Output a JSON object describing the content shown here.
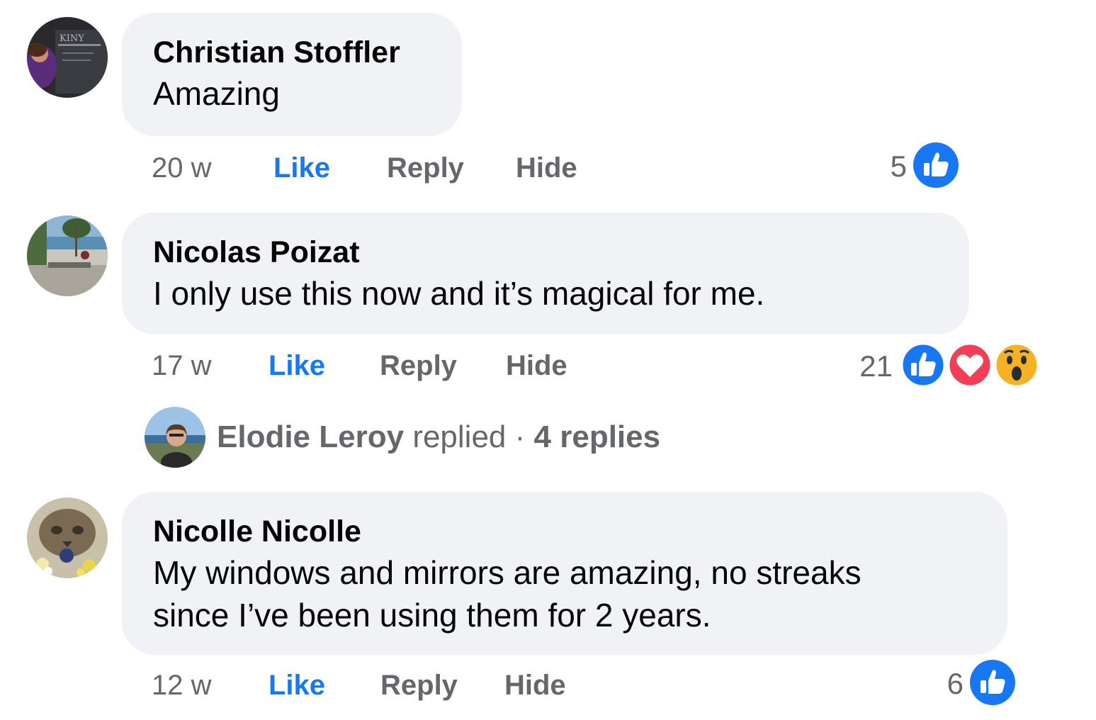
{
  "comments": [
    {
      "author": "Christian Stoffler",
      "text": "Amazing",
      "time": "20 w",
      "like_label": "Like",
      "reply_label": "Reply",
      "hide_label": "Hide",
      "reaction_count": "5",
      "reactions": [
        "like-reaction-icon"
      ]
    },
    {
      "author": "Nicolas Poizat",
      "text": "I only use this now and it’s magical for me.",
      "time": "17 w",
      "like_label": "Like",
      "reply_label": "Reply",
      "hide_label": "Hide",
      "reaction_count": "21",
      "reactions": [
        "like-reaction-icon",
        "love-reaction-icon",
        "wow-reaction-icon"
      ],
      "replies_preview": {
        "name": "Elodie Leroy",
        "replied_word": "replied",
        "separator": "·",
        "count_label": "4 replies"
      }
    },
    {
      "author": "Nicolle Nicolle",
      "text_line1": "My windows and mirrors are amazing, no streaks",
      "text_line2": "since I’ve been using them for 2 years.",
      "time": "12 w",
      "like_label": "Like",
      "reply_label": "Reply",
      "hide_label": "Hide",
      "reaction_count": "6",
      "reactions": [
        "like-reaction-icon"
      ]
    }
  ],
  "colors": {
    "bubble": "#f0f2f5",
    "like_blue": "#1877f2",
    "muted": "#65676b",
    "love_red": "#f33e58",
    "wow_yellow": "#f7b125"
  }
}
